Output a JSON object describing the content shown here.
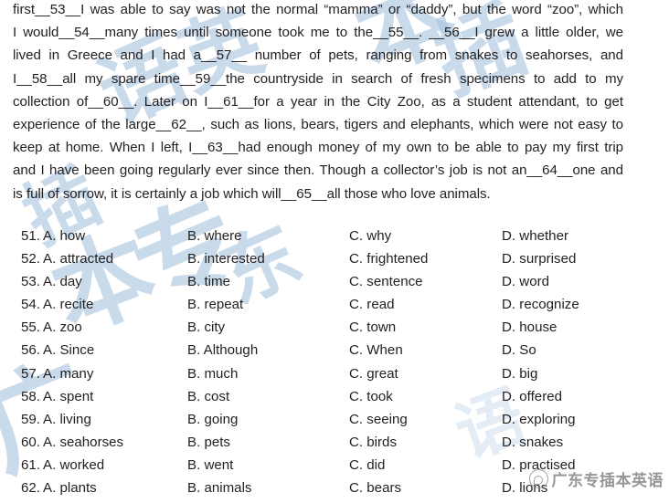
{
  "document": {
    "type": "english-cloze-exam-page",
    "text_color": "#231f20",
    "background_color": "#ffffff"
  },
  "passage": {
    "lines": [
      "first__53__I was able to say was not the normal “mamma” or “daddy”, but the word “zoo”, which",
      "I would__54__many times until someone took me to the__55__. __56__I grew a little older, we",
      "lived in Greece and I had a__57__ number of pets, ranging from snakes to seahorses, and",
      "I__58__all my spare time__59__the countryside in search of fresh specimens to add to my",
      "collection of__60__. Later on I__61__for a year in the City Zoo, as a student attendant, to get",
      "experience of the large__62__, such as lions, bears, tigers and elephants, which were not easy to",
      "keep at home. When I left, I__63__had enough money of my own to be able to pay my first trip",
      "and I have been going regularly ever since then. Though a collector’s job is not an__64__one and",
      "is full of sorrow, it is certainly a job which will__65__all those who love animals."
    ]
  },
  "options": {
    "rows": [
      {
        "num": "51.",
        "a": "A. how",
        "b": "B. where",
        "c": "C. why",
        "d": "D. whether"
      },
      {
        "num": "52.",
        "a": "A. attracted",
        "b": "B. interested",
        "c": "C. frightened",
        "d": "D. surprised"
      },
      {
        "num": "53.",
        "a": "A. day",
        "b": "B. time",
        "c": "C. sentence",
        "d": "D. word"
      },
      {
        "num": "54.",
        "a": "A. recite",
        "b": "B. repeat",
        "c": "C. read",
        "d": "D. recognize"
      },
      {
        "num": "55.",
        "a": "A. zoo",
        "b": "B. city",
        "c": "C. town",
        "d": "D. house"
      },
      {
        "num": "56.",
        "a": "A. Since",
        "b": "B. Although",
        "c": "C. When",
        "d": "D. So"
      },
      {
        "num": "57.",
        "a": "A. many",
        "b": "B. much",
        "c": "C. great",
        "d": "D. big"
      },
      {
        "num": "58.",
        "a": "A. spent",
        "b": "B. cost",
        "c": "C. took",
        "d": "D. offered"
      },
      {
        "num": "59.",
        "a": "A. living",
        "b": "B. going",
        "c": "C. seeing",
        "d": "D. exploring"
      },
      {
        "num": "60.",
        "a": "A. seahorses",
        "b": "B. pets",
        "c": "C. birds",
        "d": "D. snakes"
      },
      {
        "num": "61.",
        "a": "A. worked",
        "b": "B. went",
        "c": "C. did",
        "d": "D. practised"
      },
      {
        "num": "62.",
        "a": "A. plants",
        "b": "B. animals",
        "c": "C. bears",
        "d": "D. lions"
      }
    ]
  },
  "watermarks": {
    "background": {
      "color": "#a9c6e0",
      "glyphs": [
        "广",
        "东",
        "专",
        "插",
        "本",
        "英",
        "语"
      ]
    },
    "logo": {
      "text": "广东专插本英语",
      "icon": "speech-bubble-icon",
      "color": "#7d7d7d"
    }
  }
}
